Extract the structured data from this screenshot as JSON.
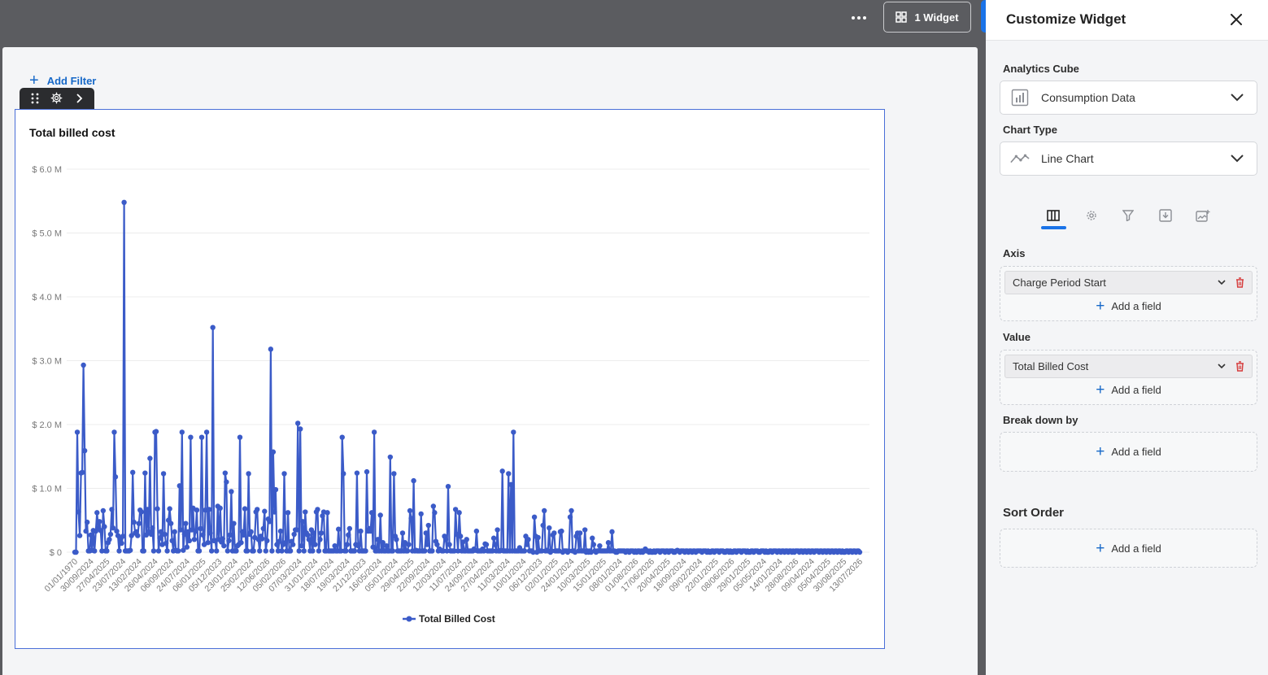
{
  "topbar": {
    "widget_button_label": "1 Widget"
  },
  "canvas": {
    "add_filter_label": "Add Filter"
  },
  "chart_data": {
    "type": "line",
    "title": "Total billed cost",
    "xlabel": "",
    "ylabel": "",
    "ylim": [
      0,
      6.0
    ],
    "y_unit": "M",
    "y_ticks": [
      "$ 0",
      "$ 1.0 M",
      "$ 2.0 M",
      "$ 3.0 M",
      "$ 4.0 M",
      "$ 5.0 M",
      "$ 6.0 M"
    ],
    "x_tick_labels": [
      "01/01/1970",
      "30/09/2024",
      "27/04/2025",
      "23/07/2024",
      "13/02/2024",
      "26/04/2024",
      "06/09/2024",
      "24/07/2024",
      "06/01/2025",
      "05/12/2023",
      "23/01/2024",
      "25/02/2024",
      "12/06/2026",
      "05/02/2026",
      "07/03/2024",
      "31/01/2024",
      "18/07/2024",
      "19/03/2024",
      "21/12/2023",
      "16/05/2024",
      "05/01/2024",
      "29/04/2025",
      "22/09/2024",
      "12/03/2024",
      "11/07/2024",
      "24/09/2024",
      "27/04/2024",
      "11/03/2024",
      "10/01/2024",
      "06/12/2023",
      "02/01/2025",
      "24/01/2024",
      "10/03/2025",
      "15/01/2025",
      "08/01/2024",
      "01/08/2026",
      "17/06/2026",
      "20/04/2025",
      "18/09/2024",
      "09/02/2024",
      "22/01/2025",
      "08/06/2026",
      "29/01/2025",
      "05/05/2024",
      "14/01/2024",
      "28/08/2026",
      "09/04/2024",
      "05/04/2025",
      "30/08/2025",
      "13/07/2026"
    ],
    "series": [
      {
        "name": "Total Billed Cost",
        "color": "#3b5bc8",
        "values": [
          0.0,
          0.0,
          1.88,
          0.63,
          0.26,
          1.24,
          1.25,
          2.93,
          1.59,
          0.33,
          0.47,
          0.02,
          0.02,
          0.27,
          0.03,
          0.34,
          0.02,
          0.33,
          0.62,
          0.38,
          0.48,
          0.34,
          0.02,
          0.65,
          0.4,
          0.02,
          0.02,
          0.15,
          0.2,
          0.28,
          0.67,
          0.38,
          1.88,
          1.18,
          0.33,
          0.26,
          0.02,
          0.21,
          0.14,
          0.25,
          5.48,
          0.02,
          0.02,
          0.02,
          0.02,
          0.03,
          0.26,
          1.25,
          0.47,
          0.3,
          0.32,
          0.26,
          0.45,
          0.66,
          0.63,
          0.02,
          0.02,
          1.24,
          0.27,
          0.67,
          0.32,
          1.47,
          0.28,
          0.38,
          0.02,
          1.88,
          1.89,
          0.68,
          0.02,
          0.22,
          0.32,
          0.12,
          1.23,
          0.28,
          0.14,
          0.02,
          0.5,
          0.68,
          0.45,
          0.18,
          0.02,
          0.32,
          0.03,
          0.02,
          0.02,
          1.04,
          0.35,
          1.88,
          0.03,
          0.28,
          0.45,
          0.08,
          0.32,
          0.18,
          1.8,
          0.35,
          0.69,
          0.2,
          0.33,
          0.66,
          0.02,
          0.02,
          0.37,
          1.8,
          0.27,
          0.12,
          0.66,
          1.88,
          0.15,
          0.67,
          0.3,
          0.02,
          3.52,
          0.18,
          0.18,
          0.02,
          0.72,
          0.2,
          0.69,
          0.16,
          0.21,
          0.1,
          1.24,
          1.1,
          0.02,
          0.18,
          0.27,
          0.95,
          0.02,
          0.45,
          0.02,
          0.02,
          0.1,
          0.12,
          1.8,
          0.15,
          0.32,
          0.27,
          0.68,
          0.02,
          0.02,
          1.23,
          0.28,
          0.32,
          0.02,
          0.02,
          0.23,
          0.63,
          0.67,
          0.2,
          0.02,
          0.25,
          0.21,
          0.37,
          0.64,
          0.02,
          0.18,
          0.52,
          0.48,
          3.18,
          0.02,
          1.57,
          0.63,
          0.98,
          0.12,
          0.02,
          0.17,
          0.33,
          0.02,
          0.12,
          1.23,
          0.15,
          0.02,
          0.62,
          0.02,
          0.02,
          0.17,
          0.12,
          0.28,
          0.35,
          0.35,
          2.02,
          0.02,
          1.93,
          0.1,
          0.48,
          0.02,
          0.63,
          0.3,
          0.27,
          0.2,
          0.02,
          0.35,
          0.02,
          0.3,
          0.12,
          0.63,
          0.67,
          0.02,
          0.2,
          0.3,
          0.57,
          0.63,
          0.02,
          0.02,
          0.62,
          0.02,
          0.02,
          0.02,
          0.02,
          0.02,
          0.1,
          0.02,
          0.02,
          0.36,
          0.02,
          0.02,
          1.8,
          1.23,
          0.02,
          0.02,
          0.12,
          0.27,
          0.37,
          0.02,
          0.02,
          0.02,
          0.02,
          0.12,
          1.24,
          0.1,
          0.02,
          0.33,
          0.02,
          0.02,
          0.02,
          0.02,
          1.26,
          0.33,
          0.37,
          0.33,
          0.62,
          0.08,
          1.88,
          0.02,
          0.02,
          0.2,
          0.02,
          0.58,
          0.02,
          0.15,
          0.02,
          0.02,
          0.1,
          0.02,
          0.02,
          1.49,
          0.02,
          0.02,
          1.23,
          0.25,
          0.2,
          0.02,
          0.02,
          0.02,
          0.02,
          0.3,
          0.02,
          0.15,
          0.02,
          0.02,
          0.12,
          0.65,
          0.53,
          0.02,
          1.12,
          0.02,
          0.03,
          0.02,
          0.02,
          0.02,
          0.6,
          0.02,
          0.02,
          0.02,
          0.3,
          0.12,
          0.42,
          0.02,
          0.02,
          0.02,
          0.72,
          0.62,
          0.17,
          0.12,
          0.02,
          0.05,
          0.03,
          0.02,
          0.02,
          0.25,
          0.2,
          0.02,
          1.03,
          0.12,
          0.02,
          0.02,
          0.02,
          0.02,
          0.67,
          0.28,
          0.02,
          0.62,
          0.25,
          0.02,
          0.16,
          0.02,
          0.02,
          0.2,
          0.02,
          0.02,
          0.02,
          0.02,
          0.02,
          0.05,
          0.03,
          0.33,
          0.02,
          0.02,
          0.02,
          0.02,
          0.05,
          0.02,
          0.13,
          0.12,
          0.02,
          0.02,
          0.02,
          0.02,
          0.02,
          0.22,
          0.12,
          0.02,
          0.35,
          0.02,
          0.02,
          0.03,
          1.27,
          0.02,
          0.02,
          0.02,
          0.02,
          1.23,
          0.02,
          1.06,
          0.02,
          1.88,
          0.02,
          0.02,
          0.02,
          0.02,
          0.07,
          0.02,
          0.02,
          0.02,
          0.02,
          0.25,
          0.12,
          0.2,
          0.02,
          0.02,
          0.02,
          0.0,
          0.55,
          0.25,
          0.0,
          0.23,
          0.02,
          0.02,
          0.02,
          0.42,
          0.65,
          0.02,
          0.03,
          0.02,
          0.38,
          0.0,
          0.02,
          0.27,
          0.3,
          0.02,
          0.02,
          0.02,
          0.02,
          0.32,
          0.33,
          0.0,
          0.02,
          0.02,
          0.02,
          0.0,
          0.02,
          0.55,
          0.65,
          0.02,
          0.02,
          0.0,
          0.25,
          0.3,
          0.02,
          0.3,
          0.02,
          0.02,
          0.02,
          0.35,
          0.0,
          0.02,
          0.0,
          0.02,
          0.0,
          0.22,
          0.12,
          0.02,
          0.0,
          0.02,
          0.02,
          0.1,
          0.02,
          0.02,
          0.02,
          0.02,
          0.02,
          0.02,
          0.15,
          0.02,
          0.02,
          0.32,
          0.02,
          0.02,
          0.0,
          0.0,
          0.02,
          0.02,
          0.02,
          0.02,
          0.02,
          0.02,
          0.0,
          0.02,
          0.02,
          0.0,
          0.02,
          0.02,
          0.02,
          0.0,
          0.02,
          0.0,
          0.02,
          0.02,
          0.0,
          0.02,
          0.0,
          0.02,
          0.05,
          0.02,
          0.02,
          0.0,
          0.02,
          0.0,
          0.0,
          0.02,
          0.0,
          0.02,
          0.02,
          0.02,
          0.0,
          0.02,
          0.02,
          0.02,
          0.0,
          0.02,
          0.02,
          0.0,
          0.02,
          0.02,
          0.02,
          0.0,
          0.0,
          0.02,
          0.03,
          0.02,
          0.0,
          0.02,
          0.02,
          0.02,
          0.0,
          0.02,
          0.02,
          0.0,
          0.02,
          0.02,
          0.0,
          0.02,
          0.02,
          0.0,
          0.02,
          0.02,
          0.02,
          0.02,
          0.0,
          0.02,
          0.02,
          0.02,
          0.0,
          0.02,
          0.0,
          0.0,
          0.02,
          0.02,
          0.0,
          0.02,
          0.02,
          0.02,
          0.0,
          0.02,
          0.02,
          0.02,
          0.0,
          0.0,
          0.02,
          0.02,
          0.0,
          0.02,
          0.0,
          0.0,
          0.02,
          0.02,
          0.0,
          0.02,
          0.02,
          0.02,
          0.0,
          0.02,
          0.02,
          0.02,
          0.0,
          0.02,
          0.0,
          0.0,
          0.02,
          0.02,
          0.0,
          0.02,
          0.02,
          0.02,
          0.0,
          0.0,
          0.02,
          0.02,
          0.02,
          0.0,
          0.02,
          0.0,
          0.0,
          0.02,
          0.02,
          0.0,
          0.02,
          0.02,
          0.02,
          0.0,
          0.02,
          0.02,
          0.0,
          0.02,
          0.02,
          0.0,
          0.02,
          0.02,
          0.0,
          0.02,
          0.02,
          0.0,
          0.02,
          0.0,
          0.02,
          0.02,
          0.02,
          0.0,
          0.02,
          0.02,
          0.0,
          0.02,
          0.02,
          0.0,
          0.02,
          0.02,
          0.0,
          0.02,
          0.02,
          0.0,
          0.02,
          0.02,
          0.02,
          0.0,
          0.02,
          0.02,
          0.0,
          0.02,
          0.02,
          0.0,
          0.02,
          0.02,
          0.0,
          0.02,
          0.02,
          0.0,
          0.02,
          0.02,
          0.0,
          0.02,
          0.02,
          0.0,
          0.02,
          0.0,
          0.0,
          0.02,
          0.02,
          0.0,
          0.02,
          0.02,
          0.0,
          0.02,
          0.02,
          0.0,
          0.02,
          0.02,
          0.0
        ]
      }
    ],
    "legend": "bottom-center",
    "grid": true
  },
  "panel": {
    "title": "Customize Widget",
    "analytics_cube_label": "Analytics Cube",
    "analytics_cube_value": "Consumption Data",
    "chart_type_label": "Chart Type",
    "chart_type_value": "Line Chart",
    "tabs": [
      "columns-tab",
      "settings-tab",
      "filter-tab",
      "export-tab",
      "image-tab"
    ],
    "axis_label": "Axis",
    "axis_field": "Charge Period Start",
    "value_label": "Value",
    "value_field": "Total Billed Cost",
    "breakdown_label": "Break down by",
    "sort_label": "Sort Order",
    "add_field_label": "Add a field"
  }
}
